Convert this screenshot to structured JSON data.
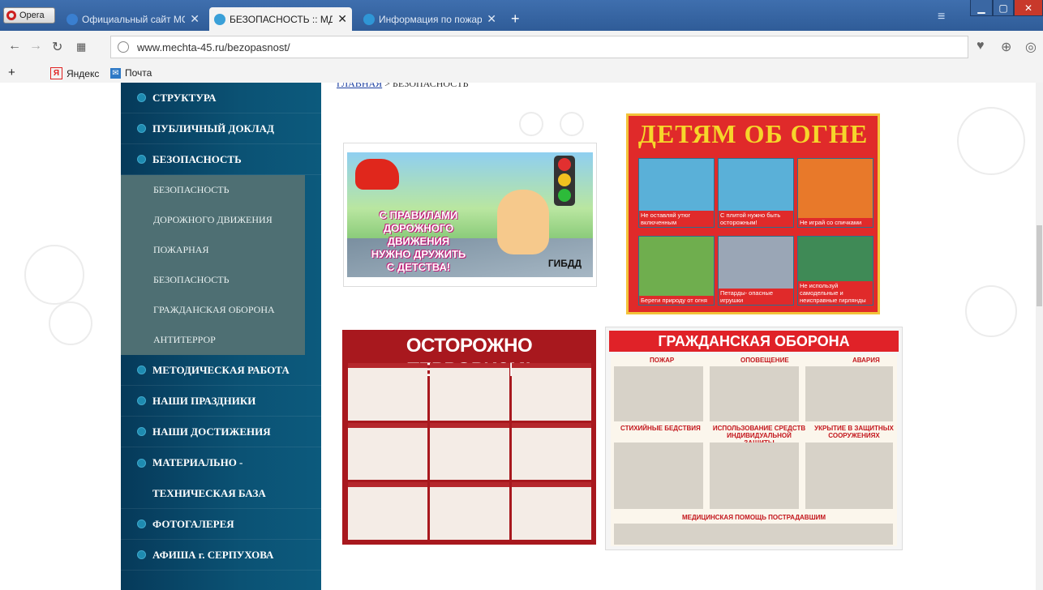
{
  "browser": {
    "opera_label": "Opera",
    "tabs": [
      {
        "title": "Официальный сайт МОУ",
        "active": false,
        "favicon_color": "#3a7fd0"
      },
      {
        "title": "БЕЗОПАСНОСТЬ :: МДОУ",
        "active": true,
        "favicon_color": "#3aa0d8"
      },
      {
        "title": "Информация по пожарн",
        "active": false,
        "favicon_color": "#2f96d6"
      }
    ],
    "new_tab_icon": "+",
    "url": "www.mechta-45.ru/bezopasnost/",
    "bookmarks": [
      {
        "label": "Яндекс",
        "icon": "yandex-icon"
      },
      {
        "label": "Почта",
        "icon": "mail-icon"
      }
    ]
  },
  "breadcrumb": {
    "home": "ГЛАВНАЯ",
    "separator": ">",
    "current": "БЕЗОПАСНОСТЬ"
  },
  "sidebar": {
    "items_top": [
      {
        "label": "СТРУКТУРА"
      },
      {
        "label": "ПУБЛИЧНЫЙ ДОКЛАД"
      },
      {
        "label": "БЕЗОПАСНОСТЬ"
      }
    ],
    "submenu": [
      {
        "label": "БЕЗОПАСНОСТЬ"
      },
      {
        "label": "ДОРОЖНОГО ДВИЖЕНИЯ"
      },
      {
        "label": "ПОЖАРНАЯ"
      },
      {
        "label": "БЕЗОПАСНОСТЬ"
      },
      {
        "label": "ГРАЖДАНСКАЯ ОБОРОНА"
      },
      {
        "label": "АНТИТЕРРОР"
      }
    ],
    "items_bottom": [
      {
        "label": "МЕТОДИЧЕСКАЯ РАБОТА"
      },
      {
        "label": "НАШИ ПРАЗДНИКИ"
      },
      {
        "label": "НАШИ ДОСТИЖЕНИЯ"
      },
      {
        "label": "МАТЕРИАЛЬНО -"
      },
      {
        "label": "ТЕХНИЧЕСКАЯ БАЗА",
        "continuation": true
      },
      {
        "label": "ФОТОГАЛЕРЕЯ"
      },
      {
        "label": "АФИША г. СЕРПУХОВА"
      }
    ]
  },
  "posters": {
    "road": {
      "lines": [
        "С ПРАВИЛАМИ",
        "ДОРОЖНОГО ДВИЖЕНИЯ",
        "НУЖНО ДРУЖИТЬ",
        "С ДЕТСТВА!"
      ],
      "badge": "ГИБДД"
    },
    "fire": {
      "title": "ДЕТЯМ ОБ ОГНЕ",
      "captions": [
        "Не оставляй утюг включенным",
        "С плитой нужно быть осторожным!",
        "Не играй со спичками",
        "Береги природу от огня",
        "Петарды- опасные игрушки",
        "Не используй самодельные и неисправные гирлянды"
      ]
    },
    "terror": {
      "title": "ОСТОРОЖНО ТЕРРОРИЗМ!"
    },
    "civil": {
      "title": "ГРАЖДАНСКАЯ ОБОРОНА",
      "labels": [
        "ПОЖАР",
        "ОПОВЕЩЕНИЕ",
        "АВАРИЯ",
        "СТИХИЙНЫЕ БЕДСТВИЯ",
        "ИСПОЛЬЗОВАНИЕ СРЕДСТВ ИНДИВИДУАЛЬНОЙ ЗАЩИТЫ",
        "УКРЫТИЕ В ЗАЩИТНЫХ СООРУЖЕНИЯХ",
        "МЕДИЦИНСКАЯ ПОМОЩЬ ПОСТРАДАВШИМ"
      ]
    }
  },
  "colors": {
    "sidebar": "#0b5274",
    "submenu": "#4e6f73",
    "poster_red": "#e02a2a"
  }
}
